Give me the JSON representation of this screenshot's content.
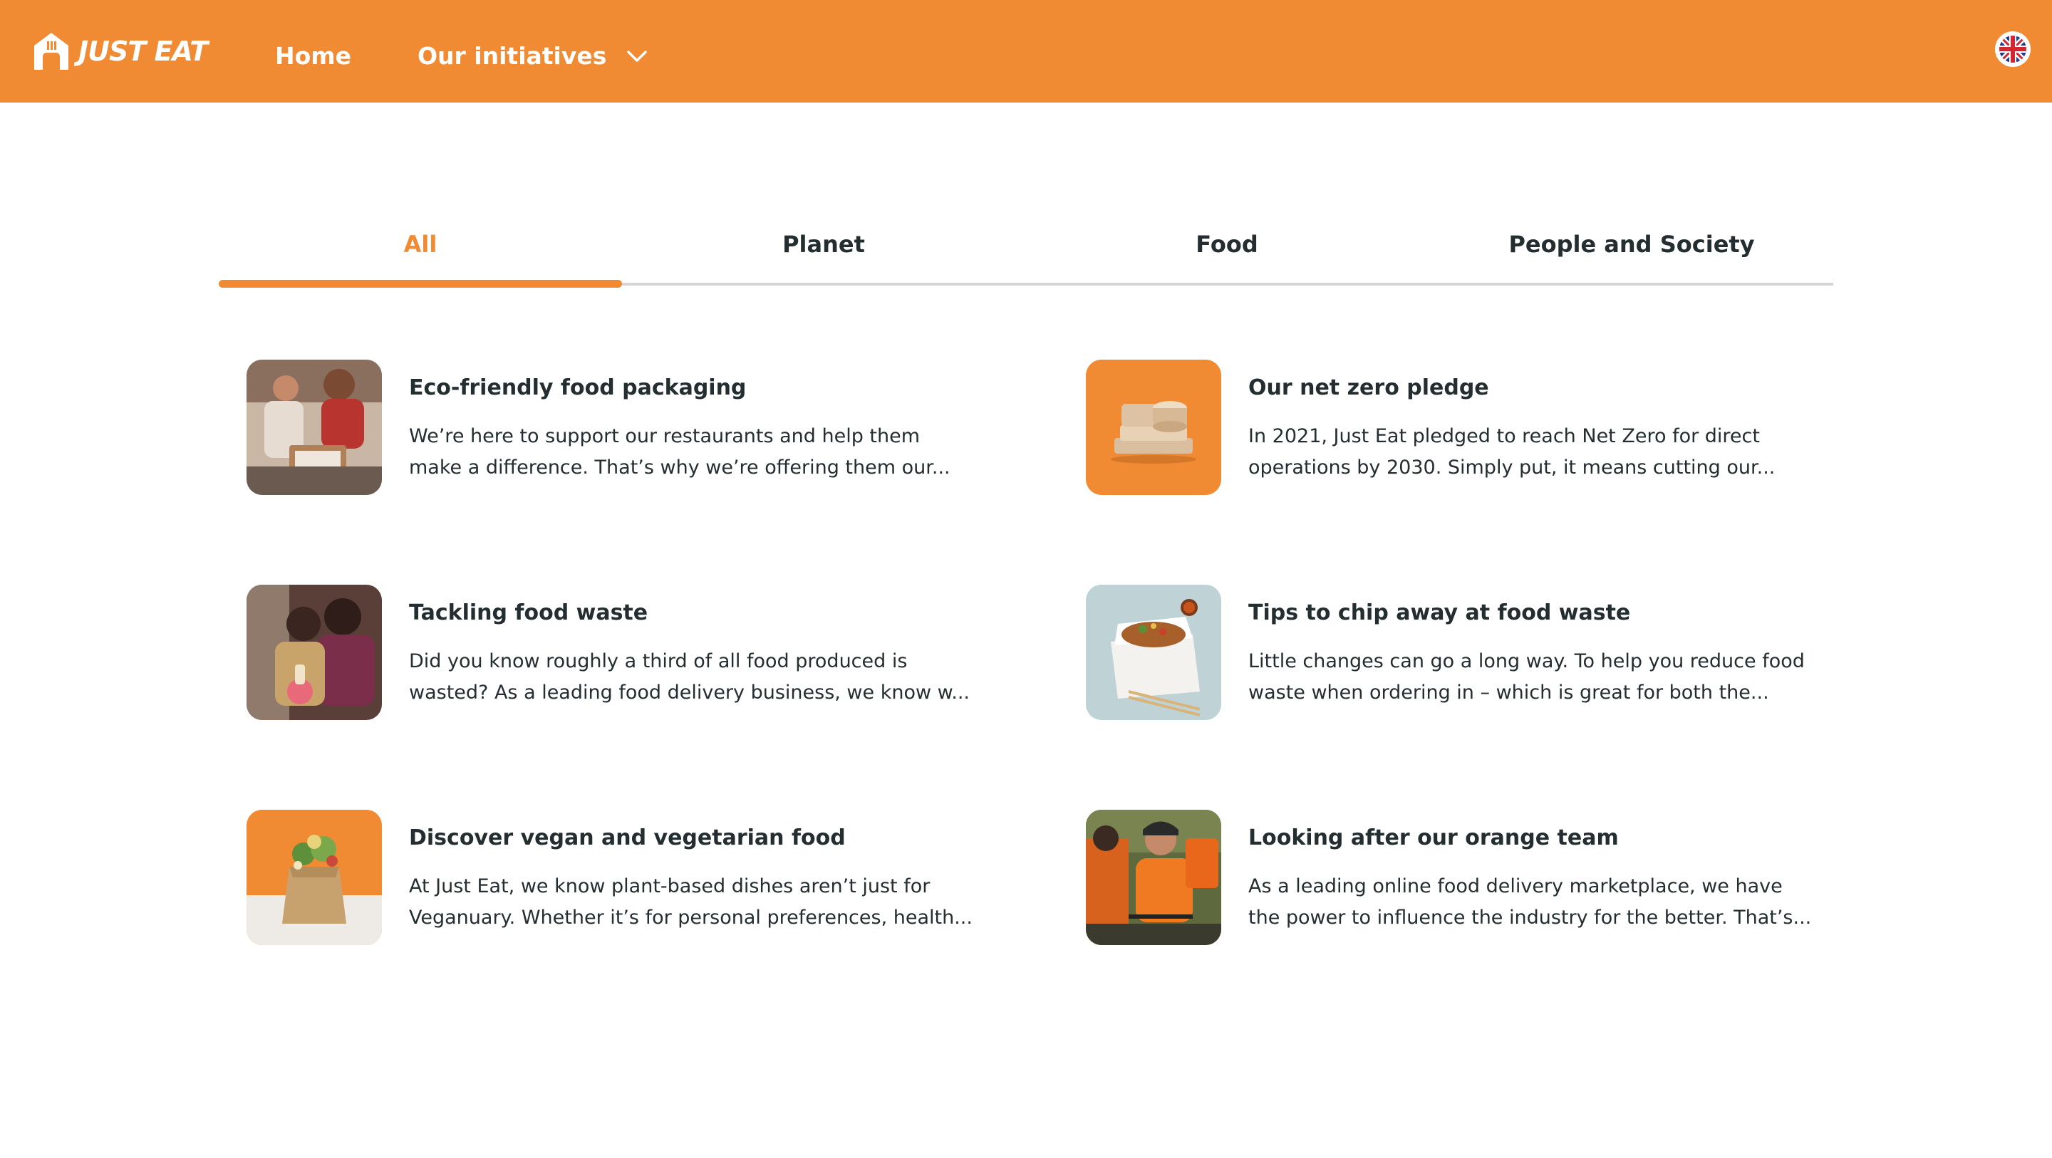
{
  "header": {
    "logo_text": "JUST EAT",
    "nav": {
      "home": "Home",
      "initiatives": "Our initiatives"
    },
    "language_icon": "uk-flag-icon",
    "brand_color": "#f08a33"
  },
  "tabs": [
    {
      "label": "All",
      "active": true
    },
    {
      "label": "Planet",
      "active": false
    },
    {
      "label": "Food",
      "active": false
    },
    {
      "label": "People and Society",
      "active": false
    }
  ],
  "cards": [
    {
      "title": "Eco-friendly food packaging",
      "desc_line1": "We’re here to support our restaurants and help them",
      "desc_line2": "make a difference. That’s why we’re offering them our..."
    },
    {
      "title": "Our net zero pledge",
      "desc_line1": "In 2021, Just Eat pledged to reach Net Zero for direct",
      "desc_line2": "operations by 2030. Simply put, it means cutting our..."
    },
    {
      "title": "Tackling food waste",
      "desc_line1": "Did you know roughly a third of all food produced is",
      "desc_line2": "wasted? As a leading food delivery business, we know w..."
    },
    {
      "title": "Tips to chip away at food waste",
      "desc_line1": "Little changes can go a long way. To help you reduce food",
      "desc_line2": "waste when ordering in – which is great for both the..."
    },
    {
      "title": "Discover vegan and vegetarian food",
      "desc_line1": "At Just Eat, we know plant-based dishes aren’t just for",
      "desc_line2": "Veganuary. Whether it’s for personal preferences, health..."
    },
    {
      "title": "Looking after our orange team",
      "desc_line1": "As a leading online food delivery marketplace, we have",
      "desc_line2": "the power to influence the industry for the better. That’s..."
    }
  ]
}
